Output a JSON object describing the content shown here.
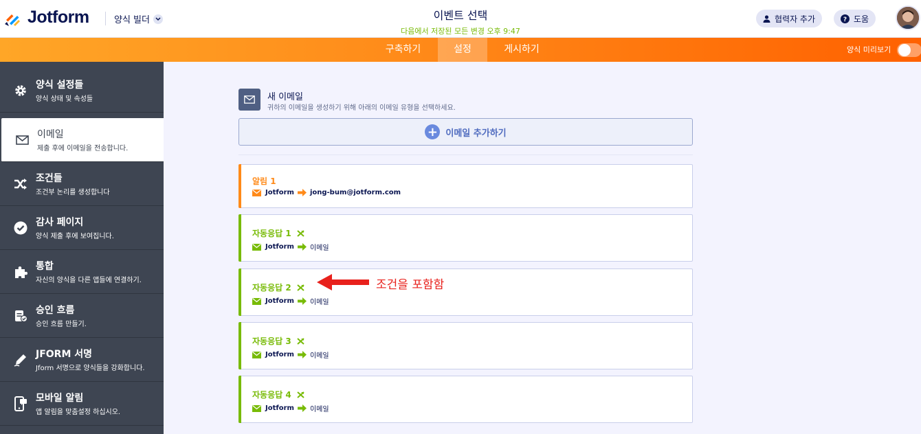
{
  "header": {
    "logo_text": "Jotform",
    "builder_label": "양식 빌더",
    "title": "이벤트 선택",
    "saved_text": "다음에서 저장된 모든 변경 오후 9:47",
    "collab_button": "협력자 추가",
    "help_button": "도움"
  },
  "nav": {
    "tabs": [
      {
        "label": "구축하기",
        "active": false
      },
      {
        "label": "설정",
        "active": true
      },
      {
        "label": "게시하기",
        "active": false
      }
    ],
    "preview_label": "양식 미리보기",
    "preview_on": false
  },
  "sidebar": {
    "items": [
      {
        "title": "양식 설정들",
        "subtitle": "양식 상태 및 속성들",
        "icon": "gear-icon",
        "active": false
      },
      {
        "title": "이메일",
        "subtitle": "제출 후에 이메일을 전송합니다.",
        "icon": "envelope-icon",
        "active": true
      },
      {
        "title": "조건들",
        "subtitle": "조건부 논리를 생성합니다",
        "icon": "shuffle-icon",
        "active": false
      },
      {
        "title": "감사 페이지",
        "subtitle": "양식 제출 후에 보여집니다.",
        "icon": "check-circle-icon",
        "active": false
      },
      {
        "title": "통합",
        "subtitle": "자신의 양식을 다른 앱들에 연결하기.",
        "icon": "puzzle-icon",
        "active": false
      },
      {
        "title": "승인 흐름",
        "subtitle": "승인 흐름 만들기.",
        "icon": "approval-icon",
        "active": false
      },
      {
        "title": "JFORM 서명",
        "subtitle": "Jform 서명으로 양식들을 강화합니다.",
        "icon": "pen-icon",
        "active": false
      },
      {
        "title": "모바일 알림",
        "subtitle": "앱 알림을 맞춤설정 하십시오.",
        "icon": "mobile-icon",
        "active": false
      }
    ]
  },
  "main": {
    "new_email_title": "새 이메일",
    "new_email_subtitle": "귀하의 이메일을 생성하기 위해 아래의 이메일 유형을 선택하세요.",
    "add_email_label": "이메일 추가하기",
    "emails": [
      {
        "name": "알림 1",
        "from": "Jotform",
        "to": "jong-bum@jotform.com",
        "type": "notification",
        "has_condition": false,
        "color": "#ff8a19"
      },
      {
        "name": "자동응답 1",
        "from": "Jotform",
        "to": "이메일",
        "type": "autoresponder",
        "has_condition": true,
        "color": "#78bb07"
      },
      {
        "name": "자동응답 2",
        "from": "Jotform",
        "to": "이메일",
        "type": "autoresponder",
        "has_condition": true,
        "color": "#78bb07"
      },
      {
        "name": "자동응답 3",
        "from": "Jotform",
        "to": "이메일",
        "type": "autoresponder",
        "has_condition": true,
        "color": "#78bb07"
      },
      {
        "name": "자동응답 4",
        "from": "Jotform",
        "to": "이메일",
        "type": "autoresponder",
        "has_condition": true,
        "color": "#78bb07"
      }
    ]
  },
  "annotation": {
    "text": "조건을 포함함",
    "color": "#e8211c"
  }
}
